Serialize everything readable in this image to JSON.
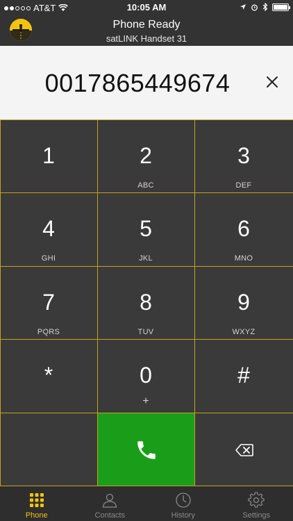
{
  "status_bar": {
    "carrier": "AT&T",
    "time": "10:05 AM"
  },
  "header": {
    "title": "Phone Ready",
    "subtitle": "satLINK Handset 31"
  },
  "display": {
    "number": "0017865449674"
  },
  "keypad": {
    "keys": [
      {
        "digit": "1",
        "letters": ""
      },
      {
        "digit": "2",
        "letters": "ABC"
      },
      {
        "digit": "3",
        "letters": "DEF"
      },
      {
        "digit": "4",
        "letters": "GHI"
      },
      {
        "digit": "5",
        "letters": "JKL"
      },
      {
        "digit": "6",
        "letters": "MNO"
      },
      {
        "digit": "7",
        "letters": "PQRS"
      },
      {
        "digit": "8",
        "letters": "TUV"
      },
      {
        "digit": "9",
        "letters": "WXYZ"
      },
      {
        "digit": "*",
        "letters": ""
      },
      {
        "digit": "0",
        "letters": "+"
      },
      {
        "digit": "#",
        "letters": ""
      }
    ]
  },
  "tabs": [
    {
      "label": "Phone",
      "icon": "keypad-grid-icon",
      "active": true
    },
    {
      "label": "Contacts",
      "icon": "contacts-icon",
      "active": false
    },
    {
      "label": "History",
      "icon": "clock-icon",
      "active": false
    },
    {
      "label": "Settings",
      "icon": "gear-icon",
      "active": false
    }
  ],
  "colors": {
    "accent": "#f2c40f",
    "call_green": "#1a9e1a",
    "key_border": "#c9a21a",
    "background": "#3a3a3a"
  }
}
